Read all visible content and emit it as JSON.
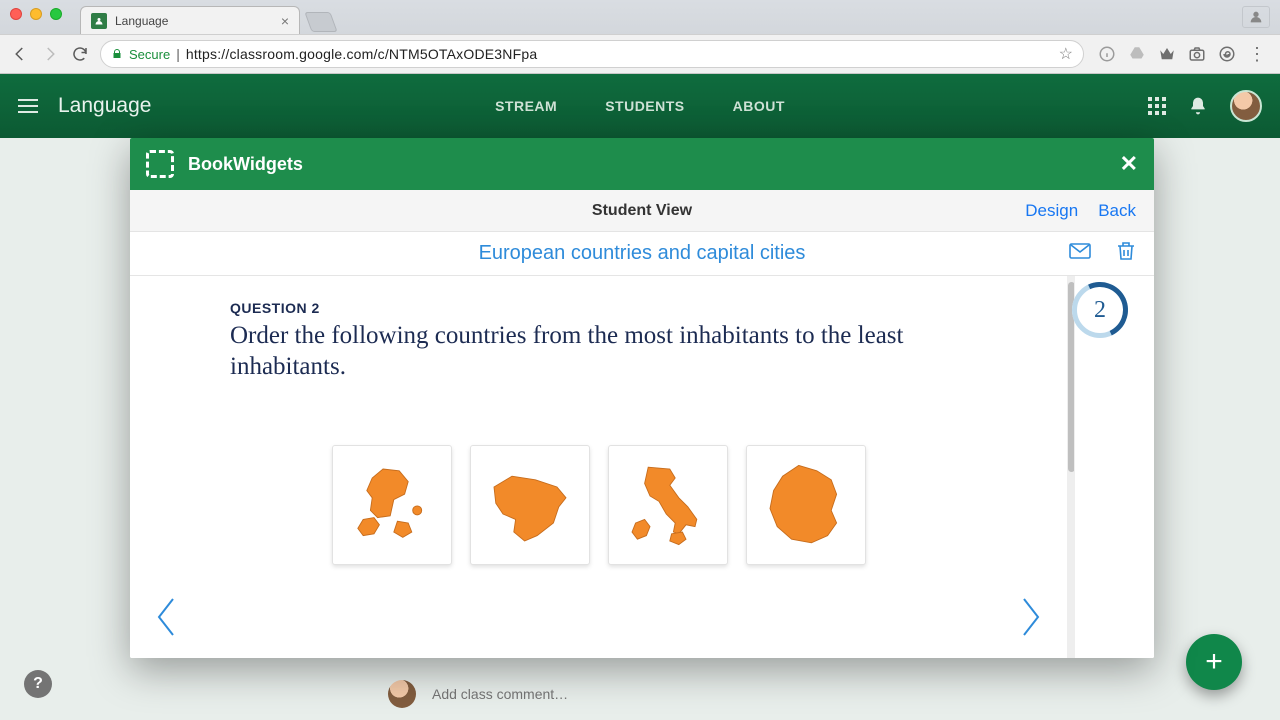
{
  "browser": {
    "tab_title": "Language",
    "secure_label": "Secure",
    "url": "https://classroom.google.com/c/NTM5OTAxODE3NFpa"
  },
  "classroom": {
    "title": "Language",
    "nav": {
      "stream": "STREAM",
      "students": "STUDENTS",
      "about": "ABOUT"
    }
  },
  "modal": {
    "brand": "BookWidgets",
    "subheader_center": "Student View",
    "subheader_links": {
      "design": "Design",
      "back": "Back"
    },
    "quiz_title": "European countries and capital cities"
  },
  "question": {
    "label": "QUESTION 2",
    "text": "Order the following countries from the most inhabitants to the least inhabitants.",
    "counter": "2",
    "cards": [
      "denmark",
      "belgium",
      "italy",
      "france"
    ]
  },
  "comment": {
    "placeholder": "Add class comment…"
  },
  "help": "?"
}
